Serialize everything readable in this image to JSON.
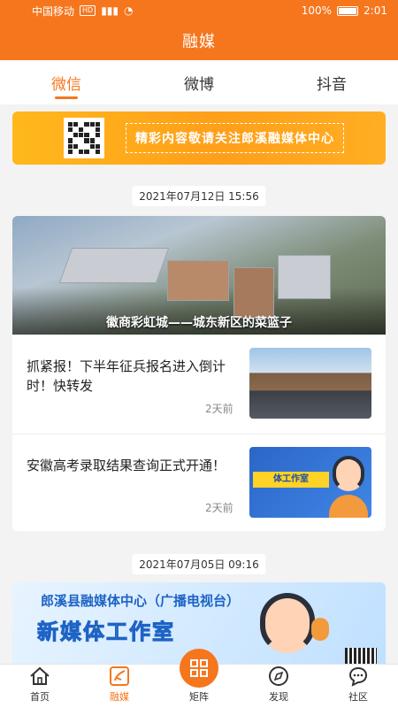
{
  "status": {
    "carrier": "中国移动",
    "net_badge": "HD",
    "signal_text": "⁴⁶",
    "battery": "100%",
    "time": "2:01"
  },
  "app": {
    "title": "融媒"
  },
  "tabs": [
    {
      "label": "微信",
      "active": true
    },
    {
      "label": "微博",
      "active": false
    },
    {
      "label": "抖音",
      "active": false
    }
  ],
  "banner": {
    "text": "精彩内容敬请关注郎溪融媒体中心"
  },
  "groups": [
    {
      "date": "2021年07月12日 15:56",
      "hero": {
        "caption": "徽商彩虹城——城东新区的菜篮子"
      },
      "items": [
        {
          "title": "抓紧报！下半年征兵报名进入倒计时！快转发",
          "time": "2天前"
        },
        {
          "title": "安徽高考录取结果查询正式开通！",
          "time": "2天前",
          "thumb_text": "体工作室"
        }
      ]
    },
    {
      "date": "2021年07月05日 09:16",
      "banner": {
        "title1": "郎溪县融媒体中心（广播电视台）",
        "title2": "新媒体工作室"
      }
    }
  ],
  "nav": [
    {
      "label": "首页",
      "icon": "home-icon",
      "active": false
    },
    {
      "label": "融媒",
      "icon": "media-icon",
      "active": true
    },
    {
      "label": "矩阵",
      "icon": "matrix-icon",
      "active": false
    },
    {
      "label": "发现",
      "icon": "compass-icon",
      "active": false
    },
    {
      "label": "社区",
      "icon": "chat-icon",
      "active": false
    }
  ],
  "colors": {
    "brand": "#f6761d",
    "banner": "#ffb81c",
    "text": "#222222"
  }
}
